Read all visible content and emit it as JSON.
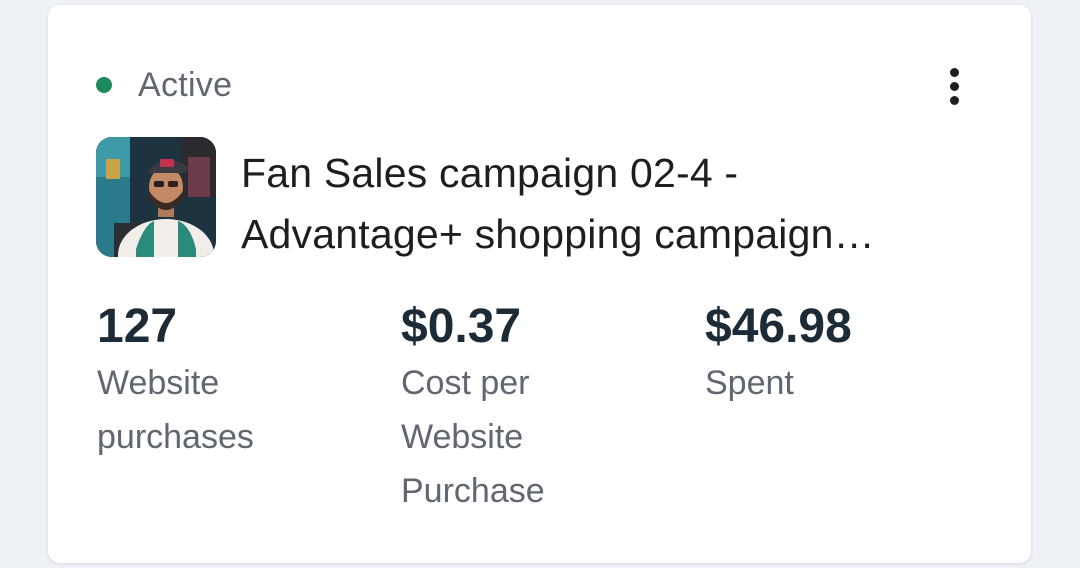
{
  "status": {
    "label": "Active",
    "color": "#1d8a5b"
  },
  "menu": {
    "icon": "more-vertical-icon"
  },
  "campaign": {
    "thumbnail": "campaign-thumbnail",
    "name_line1": "Fan Sales campaign 02-4 -",
    "name_line2": "Advantage+ shopping campaign…"
  },
  "metrics": [
    {
      "value": "127",
      "label": "Website purchases"
    },
    {
      "value": "$0.37",
      "label": "Cost per Website Purchase"
    },
    {
      "value": "$46.98",
      "label": "Spent"
    }
  ]
}
